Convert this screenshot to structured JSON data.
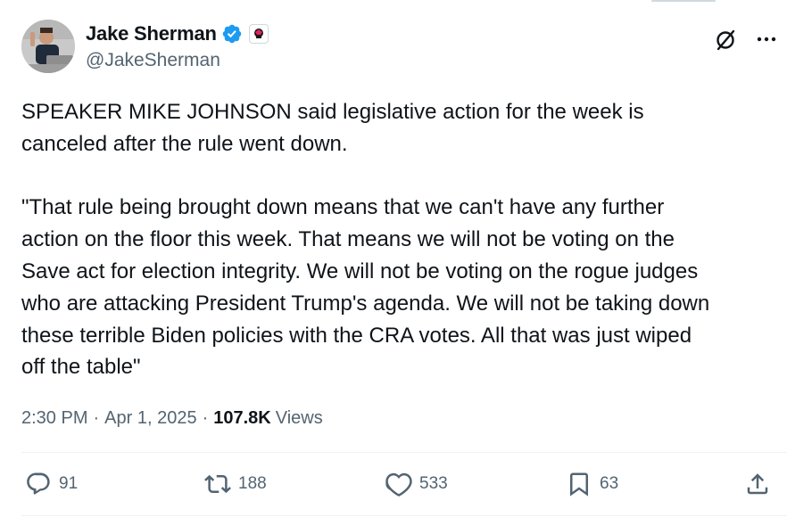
{
  "author": {
    "display_name": "Jake Sherman",
    "handle": "@JakeSherman",
    "verified_icon": "verified-badge-icon",
    "affiliate_icon": "affiliate-badge-icon"
  },
  "tweet": {
    "text": "SPEAKER MIKE JOHNSON said legislative action for the week is\ncanceled after the rule went down.\n\n\"That rule being brought down means that we can't have any further\naction on the floor this week. That means we will not be voting on the\nSave act for election integrity. We will not be voting on the rogue judges\nwho are attacking President Trump's agenda. We will not be taking down\nthese terrible Biden policies with the CRA votes. All that was just wiped\noff the table\""
  },
  "meta": {
    "time": "2:30 PM",
    "separator": "·",
    "date": "Apr 1, 2025",
    "views_count": "107.8K",
    "views_label": "Views"
  },
  "actions": {
    "replies": "91",
    "reposts": "188",
    "likes": "533",
    "bookmarks": "63"
  },
  "colors": {
    "text": "#0f1419",
    "secondary": "#536471",
    "verified": "#1d9bf0",
    "divider": "#eff3f4"
  }
}
